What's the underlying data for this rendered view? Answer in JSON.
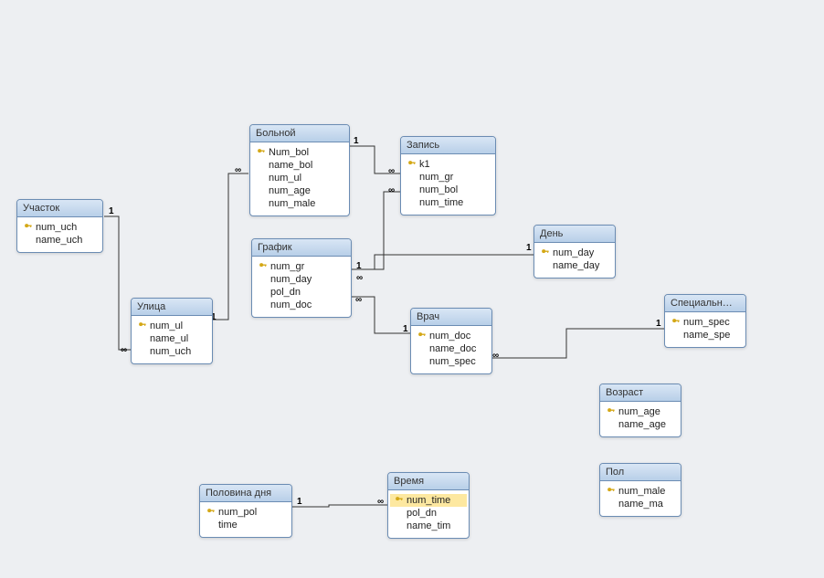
{
  "tables": {
    "uchastok": {
      "title": "Участок",
      "fields": [
        {
          "key": true,
          "name": "num_uch"
        },
        {
          "key": false,
          "name": "name_uch"
        }
      ]
    },
    "ulica": {
      "title": "Улица",
      "fields": [
        {
          "key": true,
          "name": "num_ul"
        },
        {
          "key": false,
          "name": "name_ul"
        },
        {
          "key": false,
          "name": "num_uch"
        }
      ]
    },
    "bolnoj": {
      "title": "Больной",
      "fields": [
        {
          "key": true,
          "name": "Num_bol"
        },
        {
          "key": false,
          "name": "name_bol"
        },
        {
          "key": false,
          "name": "num_ul"
        },
        {
          "key": false,
          "name": "num_age"
        },
        {
          "key": false,
          "name": "num_male"
        }
      ]
    },
    "zapis": {
      "title": "Запись",
      "fields": [
        {
          "key": true,
          "name": "k1"
        },
        {
          "key": false,
          "name": "num_gr"
        },
        {
          "key": false,
          "name": "num_bol"
        },
        {
          "key": false,
          "name": "num_time"
        }
      ]
    },
    "grafik": {
      "title": "График",
      "fields": [
        {
          "key": true,
          "name": "num_gr"
        },
        {
          "key": false,
          "name": "num_day"
        },
        {
          "key": false,
          "name": "pol_dn"
        },
        {
          "key": false,
          "name": "num_doc"
        }
      ]
    },
    "den": {
      "title": "День",
      "fields": [
        {
          "key": true,
          "name": "num_day"
        },
        {
          "key": false,
          "name": "name_day"
        }
      ]
    },
    "vrach": {
      "title": "Врач",
      "fields": [
        {
          "key": true,
          "name": "num_doc"
        },
        {
          "key": false,
          "name": "name_doc"
        },
        {
          "key": false,
          "name": "num_spec"
        }
      ]
    },
    "specialn": {
      "title": "Специальн…",
      "fields": [
        {
          "key": true,
          "name": "num_spec"
        },
        {
          "key": false,
          "name": "name_spe"
        }
      ]
    },
    "vozrast": {
      "title": "Возраст",
      "fields": [
        {
          "key": true,
          "name": "num_age"
        },
        {
          "key": false,
          "name": "name_age"
        }
      ]
    },
    "pol": {
      "title": "Пол",
      "fields": [
        {
          "key": true,
          "name": "num_male"
        },
        {
          "key": false,
          "name": "name_ma"
        }
      ]
    },
    "polovina": {
      "title": "Половина дня",
      "fields": [
        {
          "key": true,
          "name": "num_pol"
        },
        {
          "key": false,
          "name": "time"
        }
      ]
    },
    "vremya": {
      "title": "Время",
      "fields": [
        {
          "key": true,
          "name": "num_time",
          "selected": true
        },
        {
          "key": false,
          "name": "pol_dn"
        },
        {
          "key": false,
          "name": "name_tim"
        }
      ]
    }
  },
  "relationships": [
    {
      "from": "uchastok",
      "to": "ulica",
      "card_from": "1",
      "card_to": "∞"
    },
    {
      "from": "ulica",
      "to": "bolnoj",
      "card_from": "1",
      "card_to": "∞"
    },
    {
      "from": "bolnoj",
      "to": "zapis",
      "card_from": "1",
      "card_to": "∞"
    },
    {
      "from": "grafik",
      "to": "zapis",
      "card_from": "1",
      "card_to": "∞"
    },
    {
      "from": "den",
      "to": "grafik",
      "card_from": "1",
      "card_to": "∞"
    },
    {
      "from": "vrach",
      "to": "grafik",
      "card_from": "1",
      "card_to": "∞"
    },
    {
      "from": "specialn",
      "to": "vrach",
      "card_from": "1",
      "card_to": "∞"
    },
    {
      "from": "polovina",
      "to": "vremya",
      "card_from": "1",
      "card_to": "∞"
    }
  ],
  "labels": {
    "one": "1",
    "many": "∞"
  }
}
